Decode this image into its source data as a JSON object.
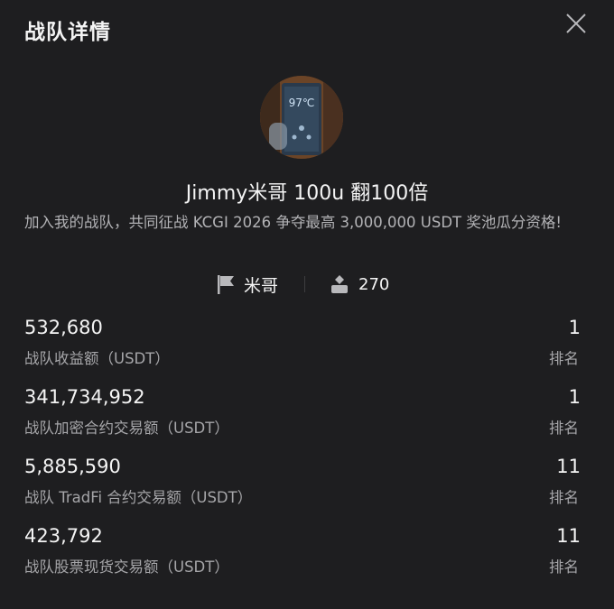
{
  "header": {
    "title": "战队详情"
  },
  "icons": {
    "close": "close-icon",
    "leader": "flag-icon",
    "members": "person-icon"
  },
  "team": {
    "name": "Jimmy米哥 100u 翻100倍",
    "description": "加入我的战队，共同征战 KCGI 2026 争夺最高 3,000,000 USDT 奖池瓜分资格!",
    "avatar_text": "97℃",
    "leader": "米哥",
    "member_count": "270"
  },
  "stats": [
    {
      "value": "532,680",
      "label": "战队收益额（USDT）",
      "rank": "1",
      "rank_label": "排名"
    },
    {
      "value": "341,734,952",
      "label": "战队加密合约交易额（USDT）",
      "rank": "1",
      "rank_label": "排名"
    },
    {
      "value": "5,885,590",
      "label": "战队 TradFi 合约交易额（USDT）",
      "rank": "11",
      "rank_label": "排名"
    },
    {
      "value": "423,792",
      "label": "战队股票现货交易额（USDT）",
      "rank": "11",
      "rank_label": "排名"
    }
  ],
  "colors": {
    "background": "#1e1e20",
    "text_primary": "#f4f4f4",
    "text_secondary": "#a6a6a9"
  }
}
